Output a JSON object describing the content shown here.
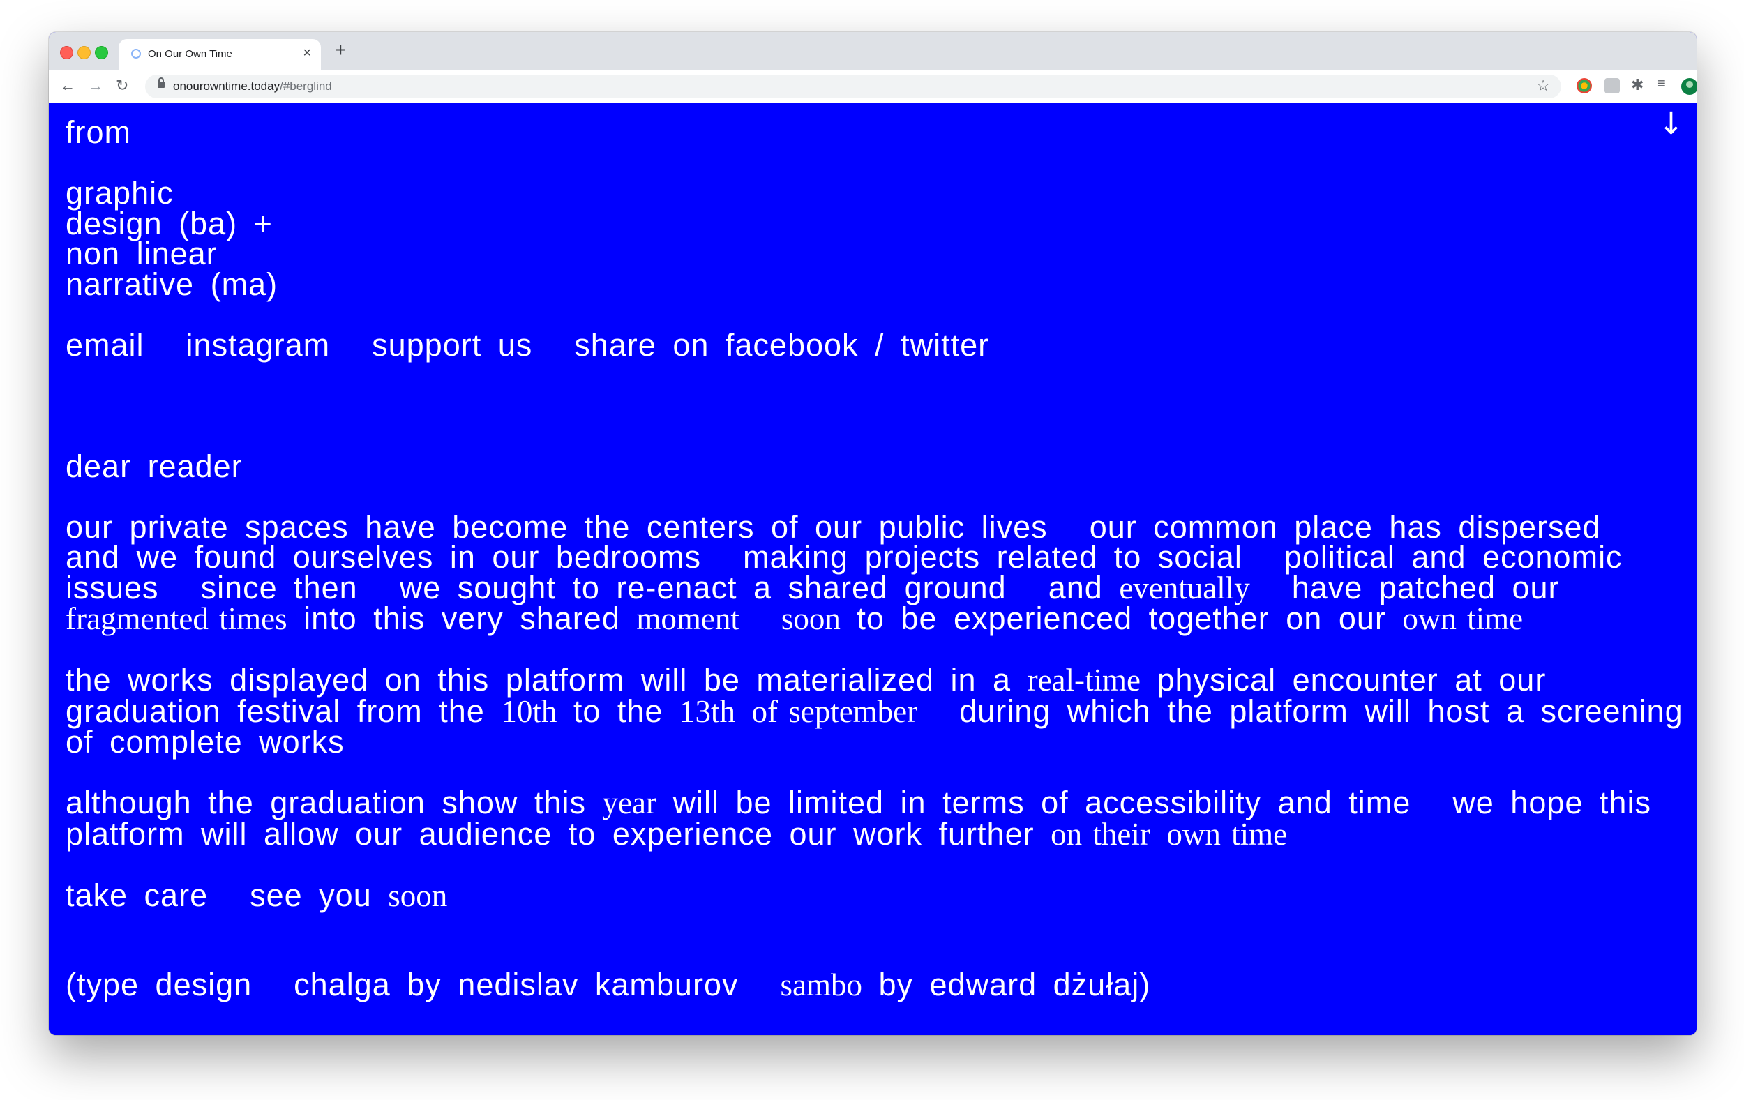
{
  "browser": {
    "tab_title": "On Our Own Time",
    "tab_close": "×",
    "new_tab": "+",
    "url_host": "onourowntime.today",
    "url_path": "/#berglind"
  },
  "page": {
    "scroll_arrow": "↓",
    "from": "from",
    "programs": [
      "graphic",
      "design (ba) +",
      "non linear",
      "narrative (ma)"
    ],
    "links": {
      "email": "email",
      "instagram": "instagram",
      "support": "support us",
      "share_prefix": "share on",
      "facebook": "facebook",
      "slash": "/",
      "twitter": "twitter"
    },
    "greeting": "dear reader",
    "p1": [
      "our private spaces have become the centers of our public lives",
      "our common place has dispersed",
      "and we found ourselves in our bedrooms",
      "making projects related to social",
      "political and economic issues",
      "since then",
      "we sought to re-enact a shared ground",
      "and",
      "eventually",
      "have patched our",
      "fragmented times",
      "into this very shared",
      "moment",
      "soon",
      "to be experienced together on our",
      "own time"
    ],
    "p2": [
      "the works displayed on this platform will be materialized in a",
      "real-time",
      "physical encounter at our graduation festival from the",
      "10th",
      "to the",
      "13th",
      "of september",
      "during which the platform will host a screening of complete works"
    ],
    "p3": [
      "although the graduation show this",
      "year",
      "will be limited in terms of accessibility and time",
      "we hope this platform will allow our audience to experience our work further",
      "on their",
      "own time"
    ],
    "p4": [
      "take care",
      "see you",
      "soon"
    ],
    "credits": [
      "(type design",
      "chalga by nedislav kamburov",
      "sambo",
      "by edward dżułaj)"
    ]
  }
}
